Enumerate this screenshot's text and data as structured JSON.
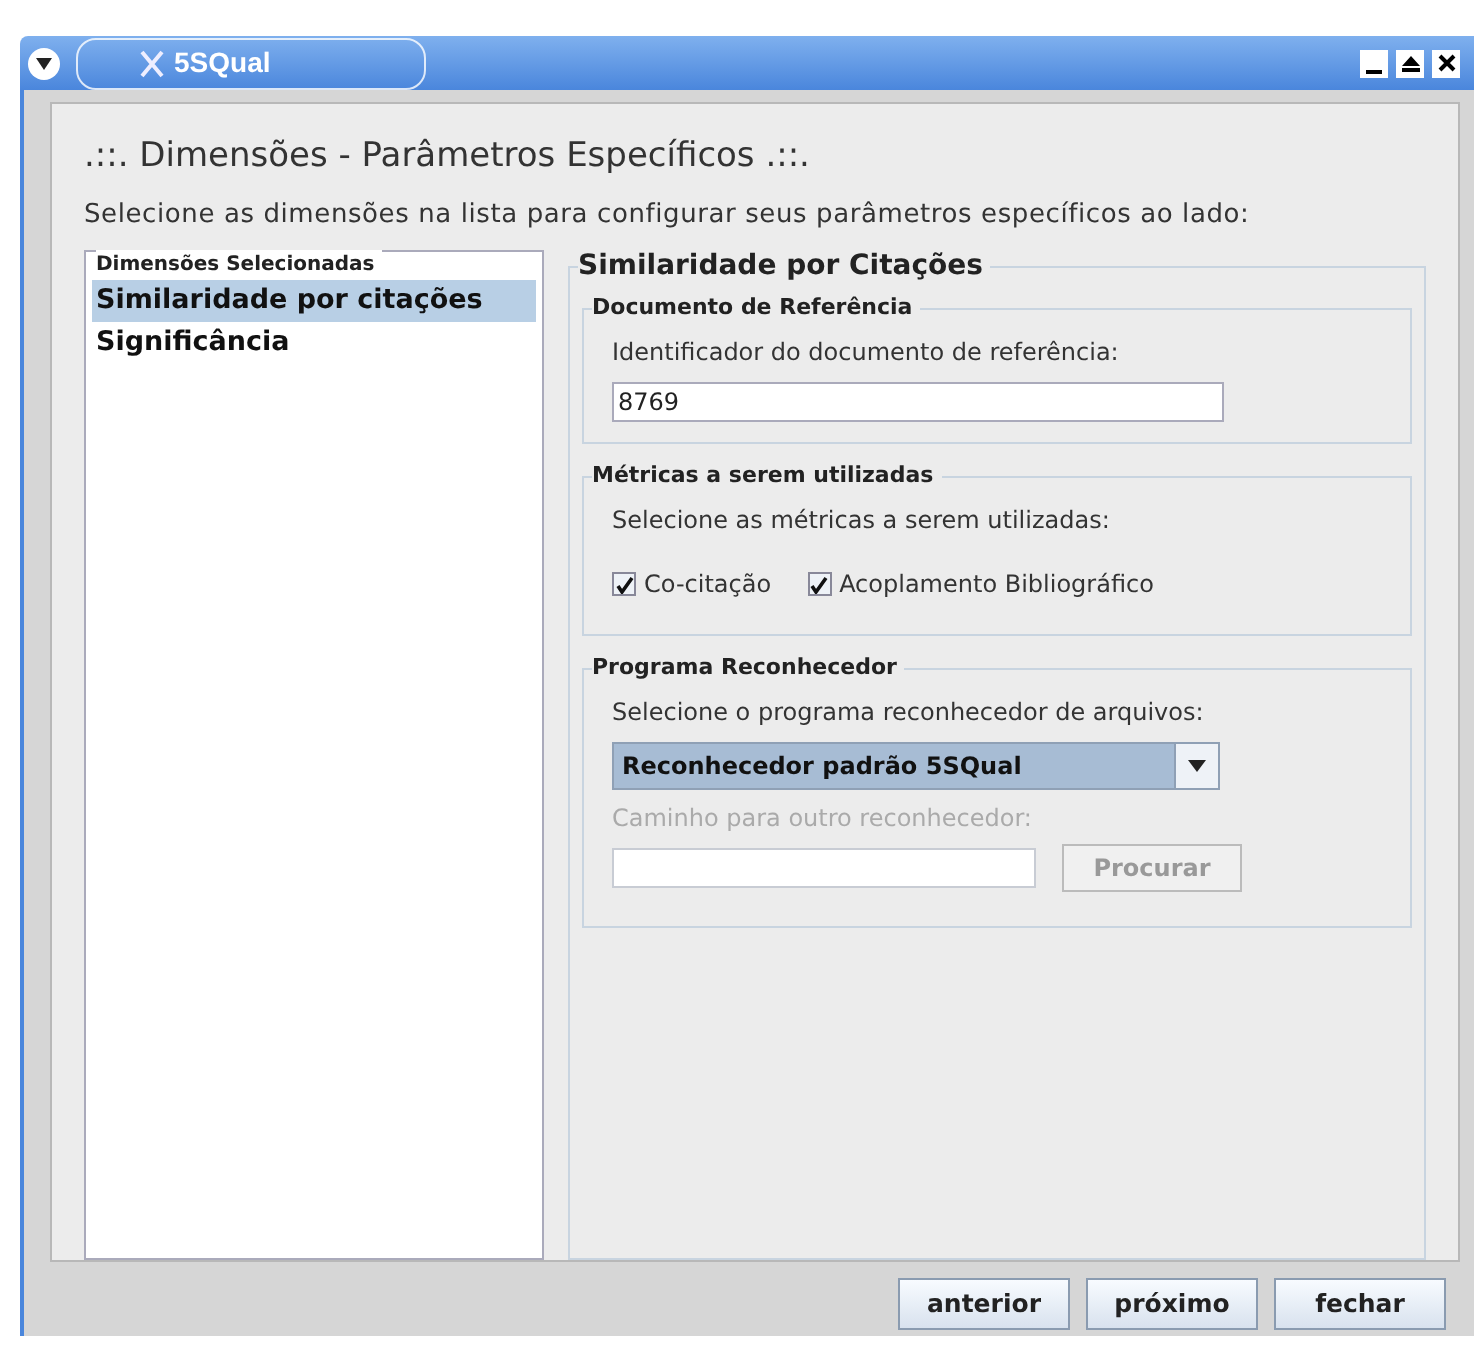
{
  "window": {
    "title": "5SQual"
  },
  "heading": ".::. Dimensões - Parâmetros Específicos .::.",
  "instruction": "Selecione as dimensões na lista para configurar seus parâmetros específicos ao lado:",
  "dimensions": {
    "legend": "Dimensões Selecionadas",
    "items": [
      {
        "label": "Similaridade por citações",
        "selected": true
      },
      {
        "label": "Significância",
        "selected": false
      }
    ]
  },
  "parameters": {
    "legend": "Similaridade por Citações",
    "reference": {
      "legend": "Documento de Referência",
      "label": "Identificador do documento de referência:",
      "value": "8769"
    },
    "metrics": {
      "legend": "Métricas a serem utilizadas",
      "label": "Selecione as métricas a serem utilizadas:",
      "options": [
        {
          "label": "Co-citação",
          "checked": true
        },
        {
          "label": "Acoplamento Bibliográfico",
          "checked": true
        }
      ]
    },
    "recognizer": {
      "legend": "Programa Reconhecedor",
      "label": "Selecione o programa reconhecedor de arquivos:",
      "selected_value": "Reconhecedor padrão 5SQual",
      "path_label": "Caminho para outro reconhecedor:",
      "path_disabled": true,
      "browse_button": "Procurar"
    }
  },
  "buttons": [
    "anterior",
    "próximo",
    "fechar"
  ]
}
